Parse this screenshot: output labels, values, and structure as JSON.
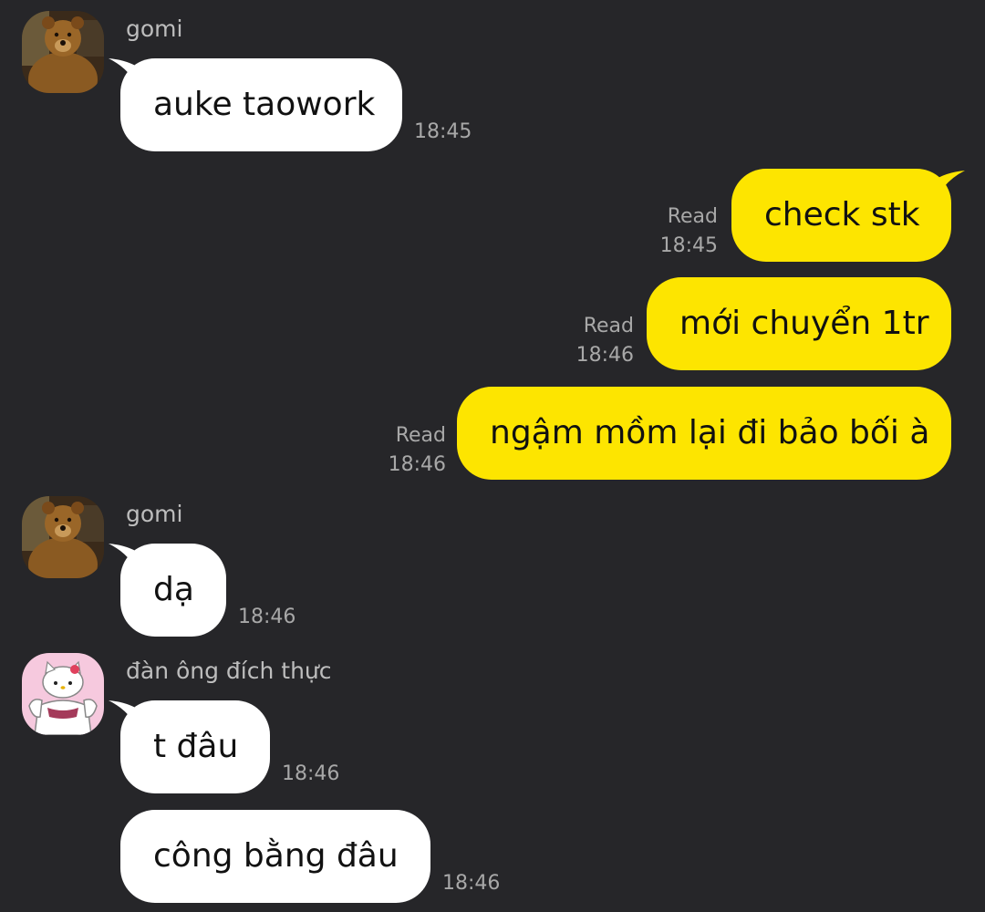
{
  "colors": {
    "background": "#262629",
    "incoming_bubble": "#ffffff",
    "outgoing_bubble": "#fde500",
    "meta_text": "#a8a8a8",
    "sender_text": "#bdbdbd"
  },
  "icons": {
    "bear_avatar": "bear-avatar-icon",
    "kitty_avatar": "muscular-kitty-avatar-icon"
  },
  "messages": [
    {
      "sender": "gomi",
      "direction": "incoming",
      "text": "auke taowork",
      "time": "18:45"
    },
    {
      "direction": "outgoing",
      "text": "check stk",
      "status": "Read",
      "time": "18:45"
    },
    {
      "direction": "outgoing",
      "text": "mới chuyển 1tr",
      "status": "Read",
      "time": "18:46"
    },
    {
      "direction": "outgoing",
      "text": "ngậm mồm lại đi bảo bối à",
      "status": "Read",
      "time": "18:46"
    },
    {
      "sender": "gomi",
      "direction": "incoming",
      "text": "dạ",
      "time": "18:46"
    },
    {
      "sender": "đàn ông đích thực",
      "direction": "incoming",
      "text": "t đâu",
      "time": "18:46"
    },
    {
      "direction": "incoming",
      "text": "công bằng đâu",
      "time": "18:46"
    }
  ]
}
